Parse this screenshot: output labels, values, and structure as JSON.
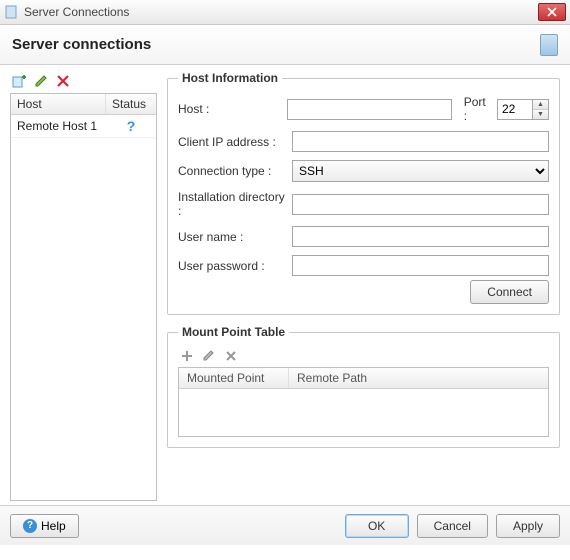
{
  "window": {
    "title": "Server Connections"
  },
  "header": {
    "title": "Server connections"
  },
  "left_toolbar": {
    "add_icon": "add-server-icon",
    "edit_icon": "edit-server-icon",
    "delete_icon": "delete-server-icon"
  },
  "host_list": {
    "columns": {
      "host": "Host",
      "status": "Status"
    },
    "rows": [
      {
        "host": "Remote Host 1",
        "status": "?"
      }
    ]
  },
  "host_info": {
    "legend": "Host Information",
    "host_label": "Host :",
    "host_value": "",
    "port_label": "Port :",
    "port_value": "22",
    "client_ip_label": "Client IP address :",
    "client_ip_value": "",
    "conn_type_label": "Connection type :",
    "conn_type_value": "SSH",
    "conn_type_options": [
      "SSH"
    ],
    "install_dir_label": "Installation directory :",
    "install_dir_value": "",
    "username_label": "User name :",
    "username_value": "",
    "password_label": "User password :",
    "password_value": "",
    "connect_label": "Connect"
  },
  "mount": {
    "legend": "Mount Point Table",
    "columns": {
      "mounted": "Mounted Point",
      "remote": "Remote Path"
    }
  },
  "footer": {
    "help": "Help",
    "ok": "OK",
    "cancel": "Cancel",
    "apply": "Apply"
  }
}
